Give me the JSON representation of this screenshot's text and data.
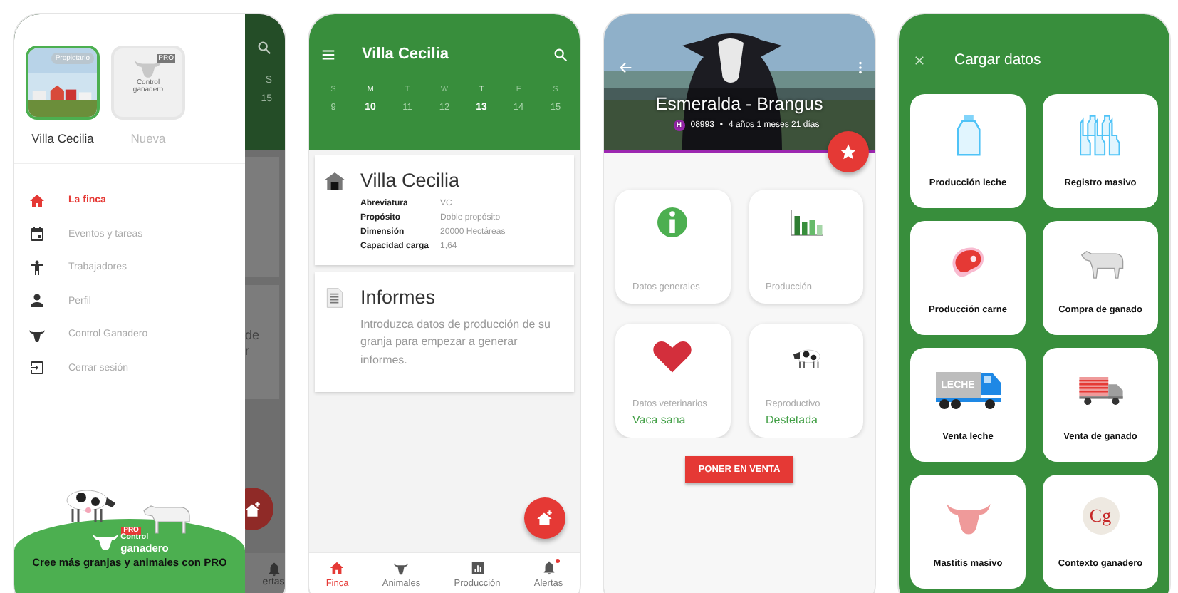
{
  "drawer_screen": {
    "farms": [
      {
        "name": "Villa Cecilia",
        "badge": "Propietario",
        "selected": true
      },
      {
        "name": "Nueva",
        "kind": "logo",
        "badge": "PRO",
        "logo_text": "Control ganadero",
        "selected": false
      }
    ],
    "menu": [
      {
        "label": "La finca",
        "kind": "home",
        "selected": true
      },
      {
        "label": "Eventos y tareas",
        "kind": "calendar",
        "selected": false
      },
      {
        "label": "Trabajadores",
        "kind": "worker",
        "selected": false
      },
      {
        "label": "Perfil",
        "kind": "profile",
        "selected": false
      },
      {
        "label": "Control Ganadero",
        "kind": "cattle",
        "selected": false
      },
      {
        "label": "Cerrar sesión",
        "kind": "logout",
        "selected": false
      }
    ],
    "promo": {
      "badge": "PRO",
      "logo_line1": "Control",
      "logo_line2": "ganadero",
      "text": "Cree más granjas y animales con PRO"
    },
    "background": {
      "day_letter": "S",
      "day_number": "15",
      "card_fragments": [
        "de",
        "r"
      ],
      "tab_fragment": "ertas"
    }
  },
  "farm_screen": {
    "title": "Villa Cecilia",
    "week": [
      {
        "day": "S",
        "date": "9",
        "selected": false
      },
      {
        "day": "M",
        "date": "10",
        "selected": true
      },
      {
        "day": "T",
        "date": "11",
        "selected": false
      },
      {
        "day": "W",
        "date": "12",
        "selected": false
      },
      {
        "day": "T",
        "date": "13",
        "selected": true
      },
      {
        "day": "F",
        "date": "14",
        "selected": false
      },
      {
        "day": "S",
        "date": "15",
        "selected": false
      }
    ],
    "farm_card": {
      "title": "Villa Cecilia",
      "fields": [
        {
          "label": "Abreviatura",
          "value": "VC"
        },
        {
          "label": "Propósito",
          "value": "Doble propósito"
        },
        {
          "label": "Dimensión",
          "value": "20000 Hectáreas"
        },
        {
          "label": "Capacidad carga",
          "value": "1,64"
        }
      ]
    },
    "reports_card": {
      "title": "Informes",
      "text": "Introduzca datos de producción de su granja para empezar a generar informes."
    },
    "bottom_nav": [
      {
        "label": "Finca",
        "kind": "home",
        "selected": true,
        "notification": false
      },
      {
        "label": "Animales",
        "kind": "cattle",
        "selected": false,
        "notification": false
      },
      {
        "label": "Producción",
        "kind": "chart",
        "selected": false,
        "notification": false
      },
      {
        "label": "Alertas",
        "kind": "bell",
        "selected": false,
        "notification": true
      }
    ]
  },
  "animal_screen": {
    "name": "Esmeralda - Brangus",
    "sex_badge": "H",
    "id": "08993",
    "separator": "•",
    "age": "4 años 1 meses 21 días",
    "sections": [
      {
        "label": "Datos generales",
        "kind": "info"
      },
      {
        "label": "Producción",
        "kind": "chart"
      },
      {
        "label": "Datos veterinarios",
        "kind": "heart",
        "status": "Vaca sana"
      },
      {
        "label": "Reproductivo",
        "kind": "cow",
        "status": "Destetada"
      }
    ],
    "sell_button": "PONER EN VENTA"
  },
  "load_data_screen": {
    "title": "Cargar datos",
    "options": [
      {
        "label": "Producción leche",
        "kind": "bottle"
      },
      {
        "label": "Registro masivo",
        "kind": "bottles"
      },
      {
        "label": "Producción carne",
        "kind": "meat"
      },
      {
        "label": "Compra de ganado",
        "kind": "bull"
      },
      {
        "label": "Venta leche",
        "kind": "milk_truck",
        "icon_text": "LECHE"
      },
      {
        "label": "Venta de ganado",
        "kind": "cattle_truck"
      },
      {
        "label": "Mastitis masivo",
        "kind": "cow_head"
      },
      {
        "label": "Contexto ganadero",
        "kind": "logo"
      }
    ],
    "logo_text": "Cg"
  }
}
